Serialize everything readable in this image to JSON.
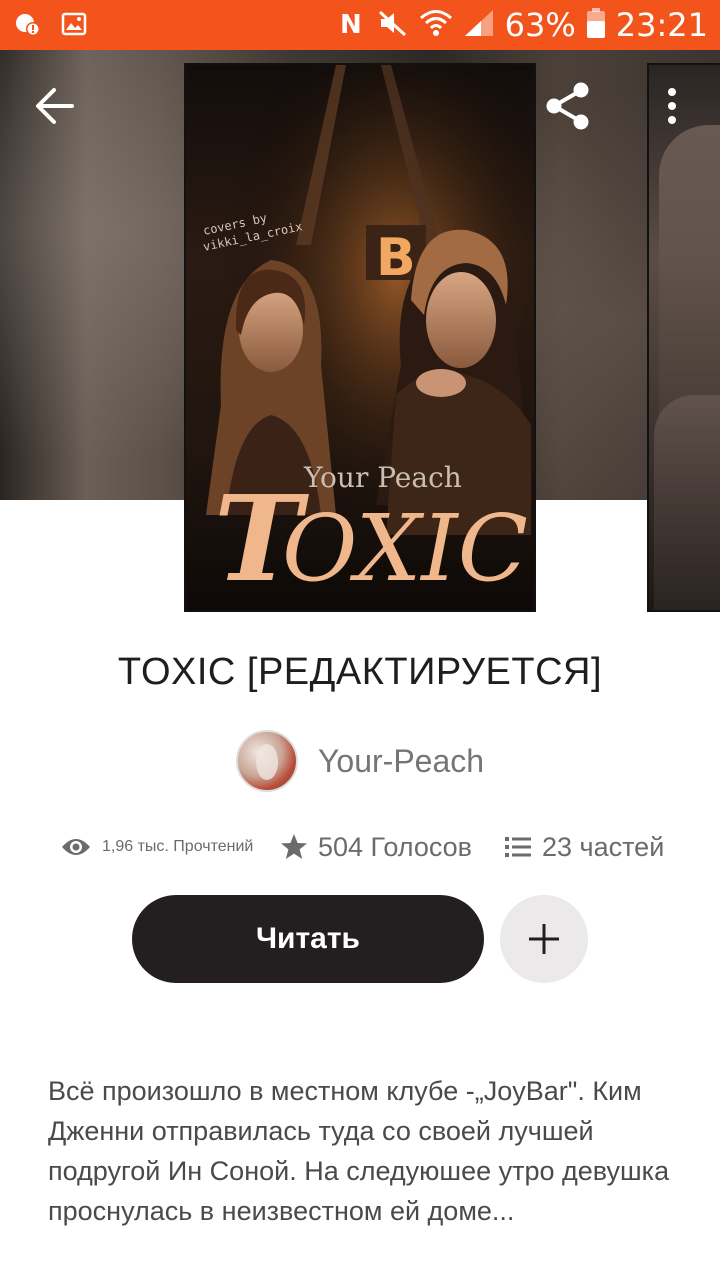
{
  "status_bar": {
    "battery": "63%",
    "time": "23:21",
    "background_color": "#f2541b",
    "icons": [
      "notification-badge-icon",
      "gallery-icon",
      "nfc-icon",
      "mute-icon",
      "wifi-icon",
      "signal-icon",
      "battery-icon"
    ]
  },
  "header": {
    "icons": [
      "back-arrow-icon",
      "share-icon",
      "more-vert-icon"
    ]
  },
  "story": {
    "title": "TOXIC [РЕДАКТИРУЕТСЯ]",
    "cover": {
      "credit": "covers by\nvikki_la_croix",
      "subtitle": "Your Peach",
      "title_art": "TOXIC"
    },
    "author": "Your-Peach",
    "stats": {
      "reads": "1,96 тыс. Прочтений",
      "votes": "504 Голосов",
      "parts": "23 частей"
    },
    "read_button": "Читать",
    "description": "Всё произошло в местном клубе -„JoyBar\". Ким Дженни отправилась туда со своей лучшей подругой Ин Соной. На следуюшее утро девушка проснулась в неизвестном ей доме..."
  },
  "colors": {
    "accent": "#f2541b",
    "read_button_bg": "#231f20",
    "add_button_bg": "#ebe9ea",
    "cover_title": "#f0b78d"
  }
}
